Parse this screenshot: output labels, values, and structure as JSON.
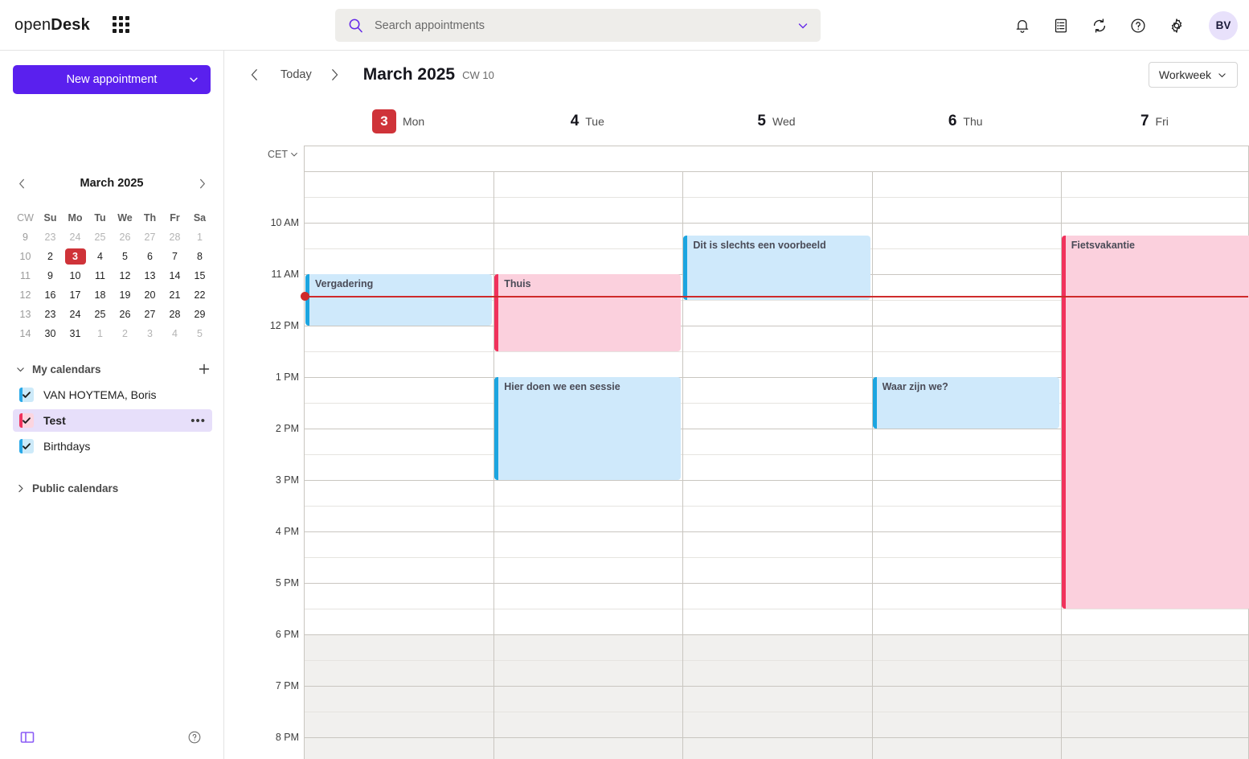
{
  "app": {
    "logo_thin": "open",
    "logo_bold": "Desk",
    "waffle_icon": "app-grid-icon"
  },
  "search": {
    "placeholder": "Search appointments",
    "value": "",
    "icon": "search-icon",
    "expand_icon": "chevron-down-icon"
  },
  "topbar_icons": [
    {
      "name": "notifications-icon",
      "label": "Notifications"
    },
    {
      "name": "tasks-icon",
      "label": "Tasks"
    },
    {
      "name": "sync-icon",
      "label": "Refresh"
    },
    {
      "name": "help-icon",
      "label": "Help"
    },
    {
      "name": "settings-icon",
      "label": "Settings"
    }
  ],
  "avatar": {
    "initials": "BV"
  },
  "sidebar": {
    "new_appointment": "New appointment",
    "new_appointment_caret": "chevron-down-icon",
    "mini_calendar": {
      "title": "March 2025",
      "prev_icon": "chevron-left-icon",
      "next_icon": "chevron-right-icon",
      "headers": [
        "CW",
        "Su",
        "Mo",
        "Tu",
        "We",
        "Th",
        "Fr",
        "Sa"
      ],
      "weeks": [
        {
          "cw": "9",
          "days": [
            {
              "n": "23",
              "out": true
            },
            {
              "n": "24",
              "out": true
            },
            {
              "n": "25",
              "out": true
            },
            {
              "n": "26",
              "out": true
            },
            {
              "n": "27",
              "out": true
            },
            {
              "n": "28",
              "out": true
            },
            {
              "n": "1",
              "out": true
            }
          ]
        },
        {
          "cw": "10",
          "days": [
            {
              "n": "2",
              "out": false
            },
            {
              "n": "3",
              "out": false,
              "today": true
            },
            {
              "n": "4",
              "out": false
            },
            {
              "n": "5",
              "out": false
            },
            {
              "n": "6",
              "out": false
            },
            {
              "n": "7",
              "out": false
            },
            {
              "n": "8",
              "out": false
            }
          ]
        },
        {
          "cw": "11",
          "days": [
            {
              "n": "9",
              "out": false
            },
            {
              "n": "10",
              "out": false
            },
            {
              "n": "11",
              "out": false
            },
            {
              "n": "12",
              "out": false
            },
            {
              "n": "13",
              "out": false
            },
            {
              "n": "14",
              "out": false
            },
            {
              "n": "15",
              "out": false
            }
          ]
        },
        {
          "cw": "12",
          "days": [
            {
              "n": "16",
              "out": false
            },
            {
              "n": "17",
              "out": false
            },
            {
              "n": "18",
              "out": false
            },
            {
              "n": "19",
              "out": false
            },
            {
              "n": "20",
              "out": false
            },
            {
              "n": "21",
              "out": false
            },
            {
              "n": "22",
              "out": false
            }
          ]
        },
        {
          "cw": "13",
          "days": [
            {
              "n": "23",
              "out": false
            },
            {
              "n": "24",
              "out": false
            },
            {
              "n": "25",
              "out": false
            },
            {
              "n": "26",
              "out": false
            },
            {
              "n": "27",
              "out": false
            },
            {
              "n": "28",
              "out": false
            },
            {
              "n": "29",
              "out": false
            }
          ]
        },
        {
          "cw": "14",
          "days": [
            {
              "n": "30",
              "out": false
            },
            {
              "n": "31",
              "out": false
            },
            {
              "n": "1",
              "out": true
            },
            {
              "n": "2",
              "out": true
            },
            {
              "n": "3",
              "out": true
            },
            {
              "n": "4",
              "out": true
            },
            {
              "n": "5",
              "out": true
            }
          ]
        }
      ]
    },
    "my_calendars": {
      "label": "My calendars",
      "collapse_icon": "chevron-down-icon",
      "add_icon": "plus-icon",
      "items": [
        {
          "label": "VAN HOYTEMA, Boris",
          "checked": true,
          "selected": false,
          "color": "#29a9e8",
          "fill": "#cdeaf9"
        },
        {
          "label": "Test",
          "checked": true,
          "selected": true,
          "color": "#f0325c",
          "fill": "#fcd5df",
          "menu_icon": "more-options-icon",
          "menu_label": "•••"
        },
        {
          "label": "Birthdays",
          "checked": true,
          "selected": false,
          "color": "#29a9e8",
          "fill": "#cdeaf9"
        }
      ]
    },
    "public_calendars": {
      "label": "Public calendars",
      "expand_icon": "chevron-right-icon"
    },
    "footer": {
      "panel_toggle_icon": "toggle-sidebar-icon",
      "help_icon": "help-circle-icon"
    }
  },
  "toolbar": {
    "prev_icon": "chevron-left-icon",
    "today": "Today",
    "next_icon": "chevron-right-icon",
    "month_title": "March 2025",
    "calendar_week": "CW 10",
    "view": "Workweek",
    "view_caret": "chevron-down-icon"
  },
  "calendar": {
    "timezone": "CET",
    "timezone_caret": "chevron-down-icon",
    "days": [
      {
        "num": "3",
        "name": "Mon",
        "today": true
      },
      {
        "num": "4",
        "name": "Tue",
        "today": false
      },
      {
        "num": "5",
        "name": "Wed",
        "today": false
      },
      {
        "num": "6",
        "name": "Thu",
        "today": false
      },
      {
        "num": "7",
        "name": "Fri",
        "today": false
      }
    ],
    "time_labels": [
      "10 AM",
      "11 AM",
      "12 PM",
      "1 PM",
      "2 PM",
      "3 PM",
      "4 PM",
      "5 PM",
      "6 PM",
      "7 PM",
      "8 PM"
    ],
    "first_hour": 9,
    "last_hour": 21,
    "work_end_hour": 18,
    "now_label": "11:25",
    "events": [
      {
        "title": "Vergadering",
        "day": 0,
        "start": 11.0,
        "end": 12.0,
        "fill": "#cfe9fb",
        "stripe": "#1ca5e0",
        "calendar": "VAN HOYTEMA, Boris"
      },
      {
        "title": "Thuis",
        "day": 1,
        "start": 11.0,
        "end": 12.5,
        "fill": "#fbd0dd",
        "stripe": "#f0325c",
        "calendar": "Test"
      },
      {
        "title": "Hier doen we een sessie",
        "day": 1,
        "start": 13.0,
        "end": 15.0,
        "fill": "#cfe9fb",
        "stripe": "#1ca5e0",
        "calendar": "VAN HOYTEMA, Boris"
      },
      {
        "title": "Dit is slechts een voorbeeld",
        "day": 2,
        "start": 10.25,
        "end": 11.5,
        "fill": "#cfe9fb",
        "stripe": "#1ca5e0",
        "calendar": "VAN HOYTEMA, Boris"
      },
      {
        "title": "Waar zijn we?",
        "day": 3,
        "start": 13.0,
        "end": 14.0,
        "fill": "#cfe9fb",
        "stripe": "#1ca5e0",
        "calendar": "VAN HOYTEMA, Boris"
      },
      {
        "title": "Fietsvakantie",
        "day": 4,
        "start": 10.25,
        "end": 17.5,
        "fill": "#fbd0dd",
        "stripe": "#f0325c",
        "calendar": "Test",
        "overflow_right": true
      }
    ]
  },
  "colors": {
    "brand_purple": "#5a20ee",
    "today_red": "#cf3339",
    "now_line": "#cf2b2b",
    "selected_row": "#e7dffa"
  }
}
